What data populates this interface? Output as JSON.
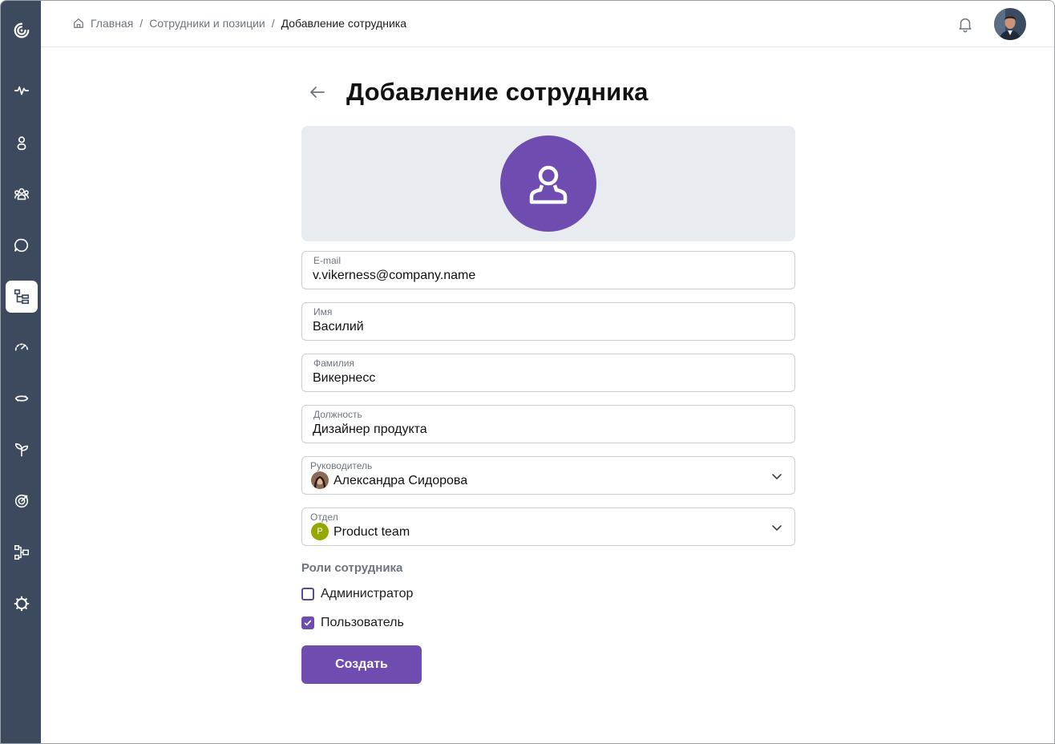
{
  "colors": {
    "sidebar_bg": "#3d4a5e",
    "accent": "#6f4db0",
    "department_badge": "#95a800"
  },
  "sidebar": {
    "items": [
      {
        "icon": "logo-spiral-icon",
        "active": false
      },
      {
        "icon": "pulse-icon",
        "active": false
      },
      {
        "icon": "person-icon",
        "active": false
      },
      {
        "icon": "team-icon",
        "active": false
      },
      {
        "icon": "chat-icon",
        "active": false
      },
      {
        "icon": "org-structure-icon",
        "active": true
      },
      {
        "icon": "speedometer-icon",
        "active": false
      },
      {
        "icon": "sync-icon",
        "active": false
      },
      {
        "icon": "sprout-icon",
        "active": false
      },
      {
        "icon": "target-icon",
        "active": false
      },
      {
        "icon": "workflow-icon",
        "active": false
      },
      {
        "icon": "settings-icon",
        "active": false
      }
    ]
  },
  "breadcrumb": {
    "home": "Главная",
    "separator": "/",
    "section": "Сотрудники и позиции",
    "current": "Добавление сотрудника"
  },
  "header": {
    "notifications_icon": "bell-icon",
    "user_avatar": "avatar"
  },
  "page": {
    "title": "Добавление сотрудника"
  },
  "form": {
    "email": {
      "label": "E-mail",
      "value": "v.vikerness@company.name"
    },
    "first_name": {
      "label": "Имя",
      "value": "Василий"
    },
    "last_name": {
      "label": "Фамилия",
      "value": "Викернесс"
    },
    "position": {
      "label": "Должность",
      "value": "Дизайнер продукта"
    },
    "manager": {
      "label": "Руководитель",
      "value": "Александра Сидорова"
    },
    "department": {
      "label": "Отдел",
      "value": "Product team",
      "badge": "P"
    }
  },
  "roles": {
    "title": "Роли сотрудника",
    "options": [
      {
        "label": "Администратор",
        "checked": false
      },
      {
        "label": "Пользователь",
        "checked": true
      }
    ]
  },
  "submit": {
    "label": "Создать"
  }
}
